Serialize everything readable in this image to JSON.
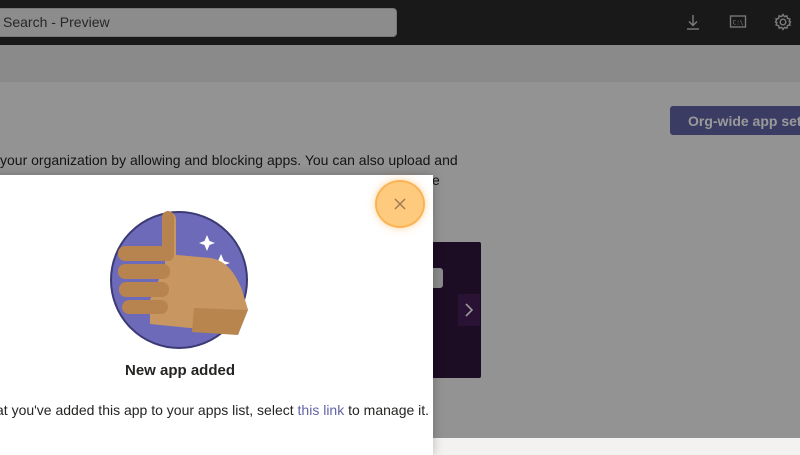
{
  "topbar": {
    "search_placeholder": "Search - Preview",
    "icons": [
      "download-icon",
      "screen-share-icon",
      "settings-icon"
    ]
  },
  "page": {
    "org_button_label": "Org-wide app setti",
    "description_line1": "your organization by allowing and blocking apps. You can also upload and",
    "description_line2": "e",
    "description_line2_suffix": "e"
  },
  "dialog": {
    "title": "New app added",
    "body_prefix": "at you've added this app to your apps list, select ",
    "link_text": "this link",
    "body_suffix": " to manage it."
  },
  "colors": {
    "accent": "#6264a7",
    "topbar": "#2b2b2b",
    "card": "#30153d",
    "highlight": "#fdca7e"
  }
}
